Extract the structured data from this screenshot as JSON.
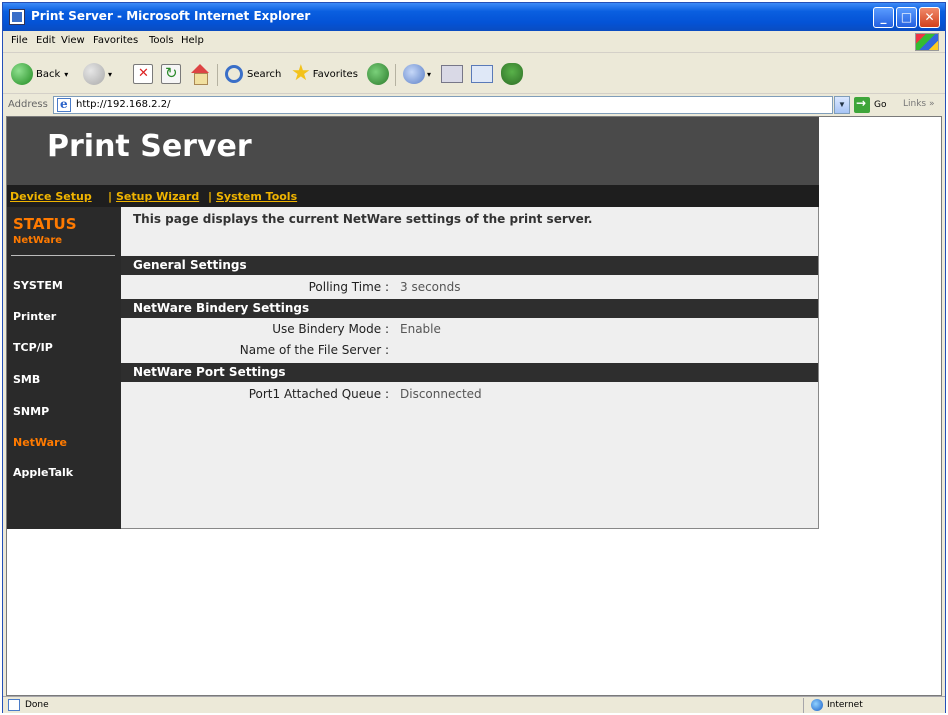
{
  "window": {
    "title": "Print Server - Microsoft Internet Explorer",
    "buttons": {
      "minimize": "_",
      "maximize": "□",
      "close": "✕"
    }
  },
  "menubar": {
    "items": [
      "File",
      "Edit",
      "View",
      "Favorites",
      "Tools",
      "Help"
    ]
  },
  "toolbar": {
    "back_label": "Back",
    "search_label": "Search",
    "favorites_label": "Favorites"
  },
  "addressbar": {
    "label": "Address",
    "url": "http://192.168.2.2/",
    "go_label": "Go",
    "links_label": "Links »"
  },
  "page": {
    "header_title": "Print Server",
    "nav": {
      "device_setup": "Device Setup",
      "setup_wizard": "Setup Wizard",
      "system_tools": "System Tools",
      "separator": "|"
    },
    "sidebar": {
      "status_title": "STATUS",
      "status_sub": "NetWare",
      "items": [
        {
          "label": "SYSTEM"
        },
        {
          "label": "Printer"
        },
        {
          "label": "TCP/IP"
        },
        {
          "label": "SMB"
        },
        {
          "label": "SNMP"
        },
        {
          "label": "NetWare",
          "active": true
        },
        {
          "label": "AppleTalk"
        }
      ]
    },
    "intro": "This page displays the current NetWare settings of the print server.",
    "sections": {
      "general": {
        "title": "General Settings",
        "polling_time_label": "Polling Time :",
        "polling_time_value": "3 seconds"
      },
      "bindery": {
        "title": "NetWare Bindery Settings",
        "use_bindery_label": "Use Bindery Mode :",
        "use_bindery_value": "Enable",
        "file_server_label": "Name of the File Server :",
        "file_server_value": ""
      },
      "port": {
        "title": "NetWare Port Settings",
        "port1_label": "Port1 Attached Queue :",
        "port1_value": "Disconnected"
      }
    }
  },
  "statusbar": {
    "status": "Done",
    "zone": "Internet"
  },
  "colors": {
    "accent_orange": "#ff7a00",
    "nav_link": "#f0b400",
    "header_bg": "#4a4a4a",
    "section_bar_bg": "#2e2e2e"
  }
}
